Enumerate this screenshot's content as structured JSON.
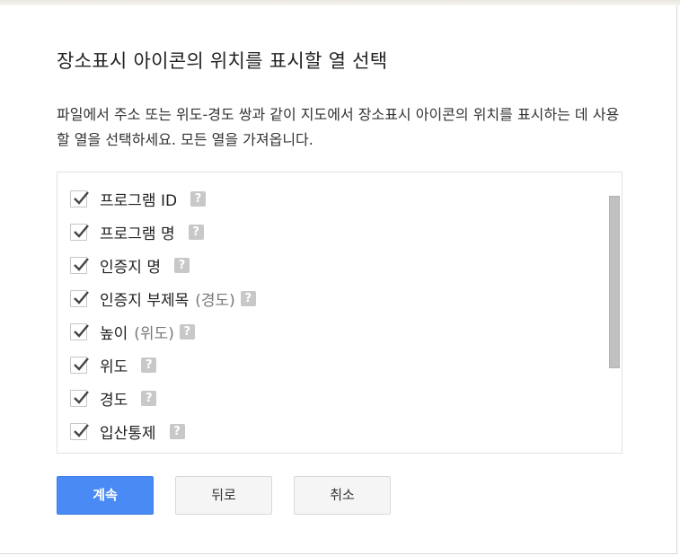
{
  "dialog": {
    "title": "장소표시 아이콘의 위치를 표시할 열 선택",
    "description": "파일에서 주소 또는 위도-경도 쌍과 같이 지도에서 장소표시 아이콘의 위치를 표시하는 데 사용할 열을 선택하세요. 모든 열을 가져옵니다."
  },
  "columns": [
    {
      "label": "프로그램 ID",
      "suffix": "",
      "checked": true
    },
    {
      "label": "프로그램 명",
      "suffix": "",
      "checked": true
    },
    {
      "label": "인증지 명",
      "suffix": "",
      "checked": true
    },
    {
      "label": "인증지 부제목",
      "suffix": "(경도)",
      "checked": true
    },
    {
      "label": "높이",
      "suffix": "(위도)",
      "checked": true
    },
    {
      "label": "위도",
      "suffix": "",
      "checked": true
    },
    {
      "label": "경도",
      "suffix": "",
      "checked": true
    },
    {
      "label": "입산통제",
      "suffix": "",
      "checked": true
    }
  ],
  "help_glyph": "?",
  "buttons": {
    "continue_label": "계속",
    "back_label": "뒤로",
    "cancel_label": "취소"
  },
  "colors": {
    "primary": "#4a8af4",
    "help_icon": "#c8c8c8",
    "scrollbar": "#c1c1c1"
  }
}
